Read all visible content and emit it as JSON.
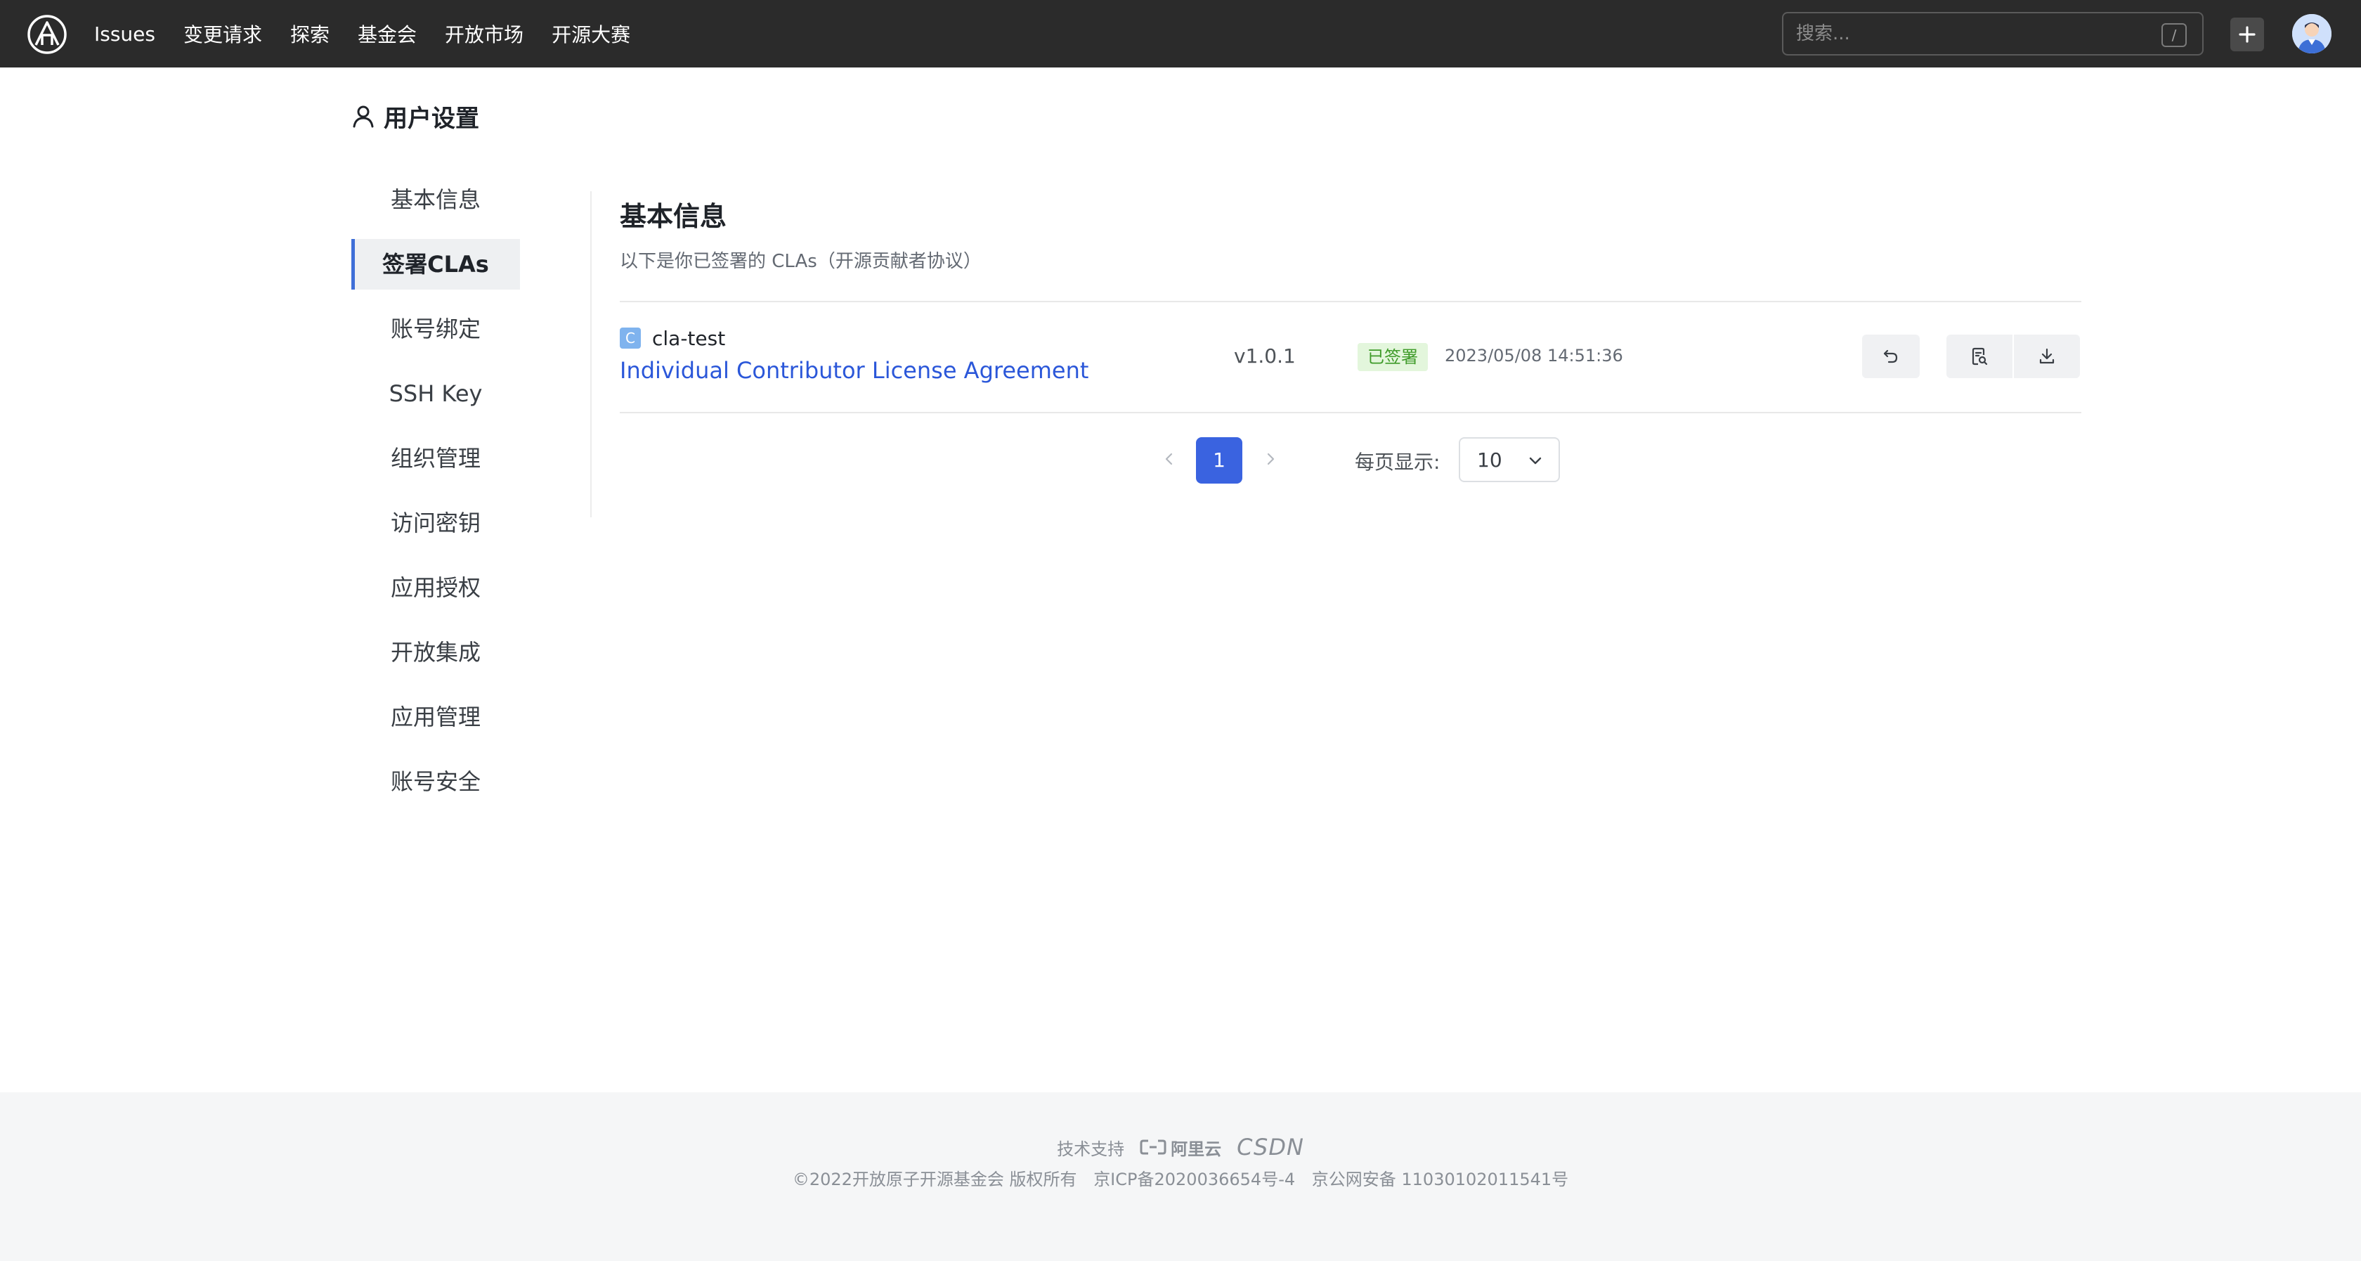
{
  "nav": {
    "items": [
      "Issues",
      "变更请求",
      "探索",
      "基金会",
      "开放市场",
      "开源大赛"
    ],
    "search_placeholder": "搜索...",
    "search_shortcut": "/"
  },
  "page": {
    "title": "用户设置"
  },
  "sidebar": {
    "items": [
      {
        "label": "基本信息"
      },
      {
        "label": "签署CLAs",
        "active": true
      },
      {
        "label": "账号绑定"
      },
      {
        "label": "SSH Key"
      },
      {
        "label": "组织管理"
      },
      {
        "label": "访问密钥"
      },
      {
        "label": "应用授权"
      },
      {
        "label": "开放集成"
      },
      {
        "label": "应用管理"
      },
      {
        "label": "账号安全"
      }
    ]
  },
  "content": {
    "heading": "基本信息",
    "description": "以下是你已签署的 CLAs（开源贡献者协议）",
    "cla": {
      "repo_badge": "C",
      "repo_name": "cla-test",
      "title": "Individual Contributor License Agreement",
      "version": "v1.0.1",
      "status": "已签署",
      "signed_at": "2023/05/08 14:51:36"
    },
    "pagination": {
      "current_page": "1",
      "per_page_label": "每页显示:",
      "per_page_value": "10"
    }
  },
  "footer": {
    "tech_support_label": "技术支持",
    "aliyun_label": "阿里云",
    "csdn_label": "CSDN",
    "copyright": "©2022开放原子开源基金会 版权所有",
    "icp": "京ICP备2020036654号-4",
    "police": "京公网安备 11030102011541号"
  },
  "colors": {
    "topbar_bg": "#2b2b2b",
    "accent": "#3a63e0",
    "link": "#2b57d9",
    "status_bg": "#e3f6dc",
    "status_text": "#3f9b2a"
  }
}
